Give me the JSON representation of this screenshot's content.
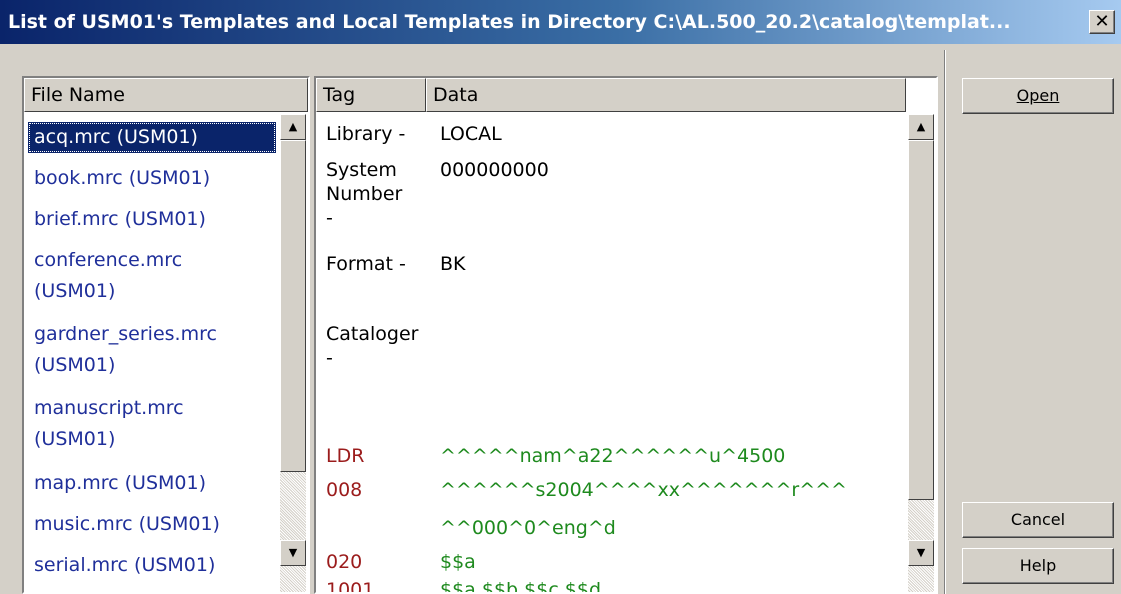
{
  "window": {
    "title": "List of USM01's Templates and Local Templates in Directory C:\\AL.500_20.2\\catalog\\templat...",
    "close_label": "✕"
  },
  "file_list": {
    "header": "File Name",
    "items": [
      {
        "label": "acq.mrc (USM01)",
        "selected": true
      },
      {
        "label": "book.mrc (USM01)"
      },
      {
        "label": "brief.mrc (USM01)"
      },
      {
        "label": "conference.mrc (USM01)"
      },
      {
        "label": "gardner_series.mrc (USM01)"
      },
      {
        "label": "manuscript.mrc (USM01)"
      },
      {
        "label": "map.mrc (USM01)"
      },
      {
        "label": "music.mrc (USM01)"
      },
      {
        "label": "serial.mrc (USM01)"
      }
    ]
  },
  "record_view": {
    "header_tag": "Tag",
    "header_data": "Data",
    "rows": [
      {
        "tag": "Library -",
        "data": "LOCAL",
        "color": "black"
      },
      {
        "tag": "System Number -",
        "data": "000000000",
        "color": "black"
      },
      {
        "tag": "Format -",
        "data": "BK",
        "color": "black"
      },
      {
        "tag": "Cataloger -",
        "data": "",
        "color": "black"
      },
      {
        "tag": "LDR",
        "data": "^^^^^nam^a22^^^^^^u^4500",
        "color": "red"
      },
      {
        "tag": "008",
        "data": "^^^^^^s2004^^^^xx^^^^^^^r^^^",
        "color": "red"
      },
      {
        "tag": "",
        "data": "^^000^0^eng^d",
        "color": "green"
      },
      {
        "tag": "020",
        "data": "$$a",
        "color": "red"
      },
      {
        "tag": "1001",
        "data": "$$a $$b $$c $$d",
        "color": "red"
      }
    ]
  },
  "buttons": {
    "open": "Open",
    "cancel": "Cancel",
    "help": "Help"
  },
  "scrollbar": {
    "up_arrow": "▲",
    "down_arrow": "▼"
  }
}
